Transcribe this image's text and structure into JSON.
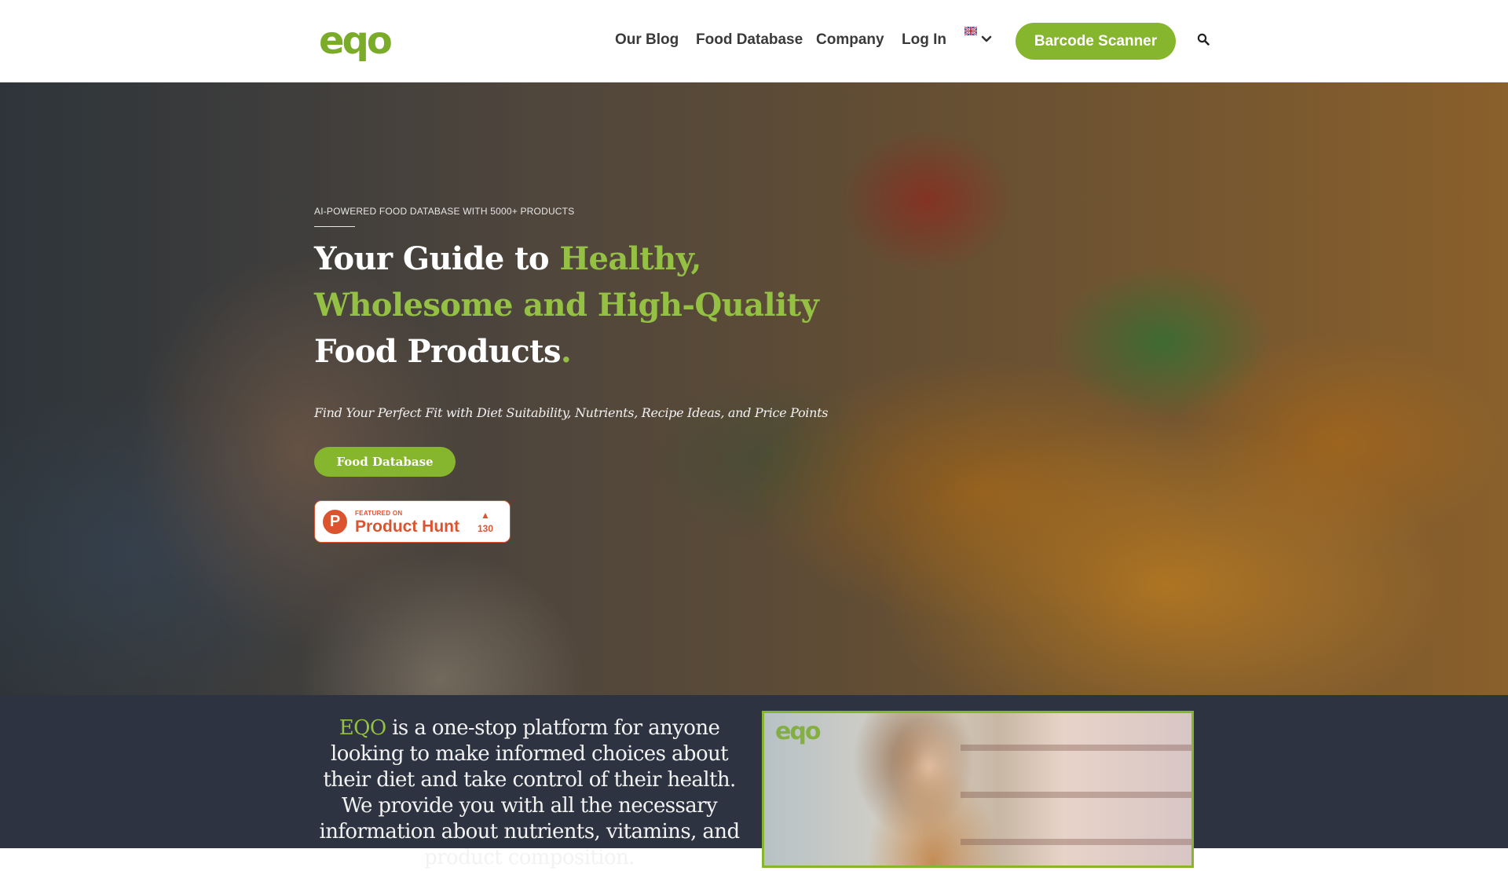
{
  "brand": {
    "logo_text": "eqo",
    "accent_color": "#86b52e"
  },
  "nav": {
    "items": [
      {
        "label": "Our Blog"
      },
      {
        "label": "Food Database"
      },
      {
        "label": "Company"
      },
      {
        "label": "Log In"
      }
    ],
    "language_icon": "uk-flag-icon",
    "cta_label": "Barcode Scanner",
    "search_icon": "search-icon"
  },
  "hero": {
    "eyebrow": "AI-POWERED FOOD DATABASE WITH 5000+ PRODUCTS",
    "headline": {
      "part1": "Your Guide to ",
      "highlight1": "Healthy,",
      "highlight2": "Wholesome and High-Quality",
      "part2": "Food Products",
      "period": "."
    },
    "subheading": "Find Your Perfect Fit with Diet Suitability, Nutrients, Recipe Ideas, and Price Points",
    "button_label": "Food Database",
    "product_hunt": {
      "logo_letter": "P",
      "small_text": "FEATURED ON",
      "name": "Product Hunt",
      "arrow": "▲",
      "upvotes": "130"
    }
  },
  "about": {
    "brand": "EQO",
    "text": " is a one-stop platform for anyone looking to make informed choices about their diet and take control of their health. We provide you with all the necessary information about nutrients, vitamins, and product composition."
  }
}
